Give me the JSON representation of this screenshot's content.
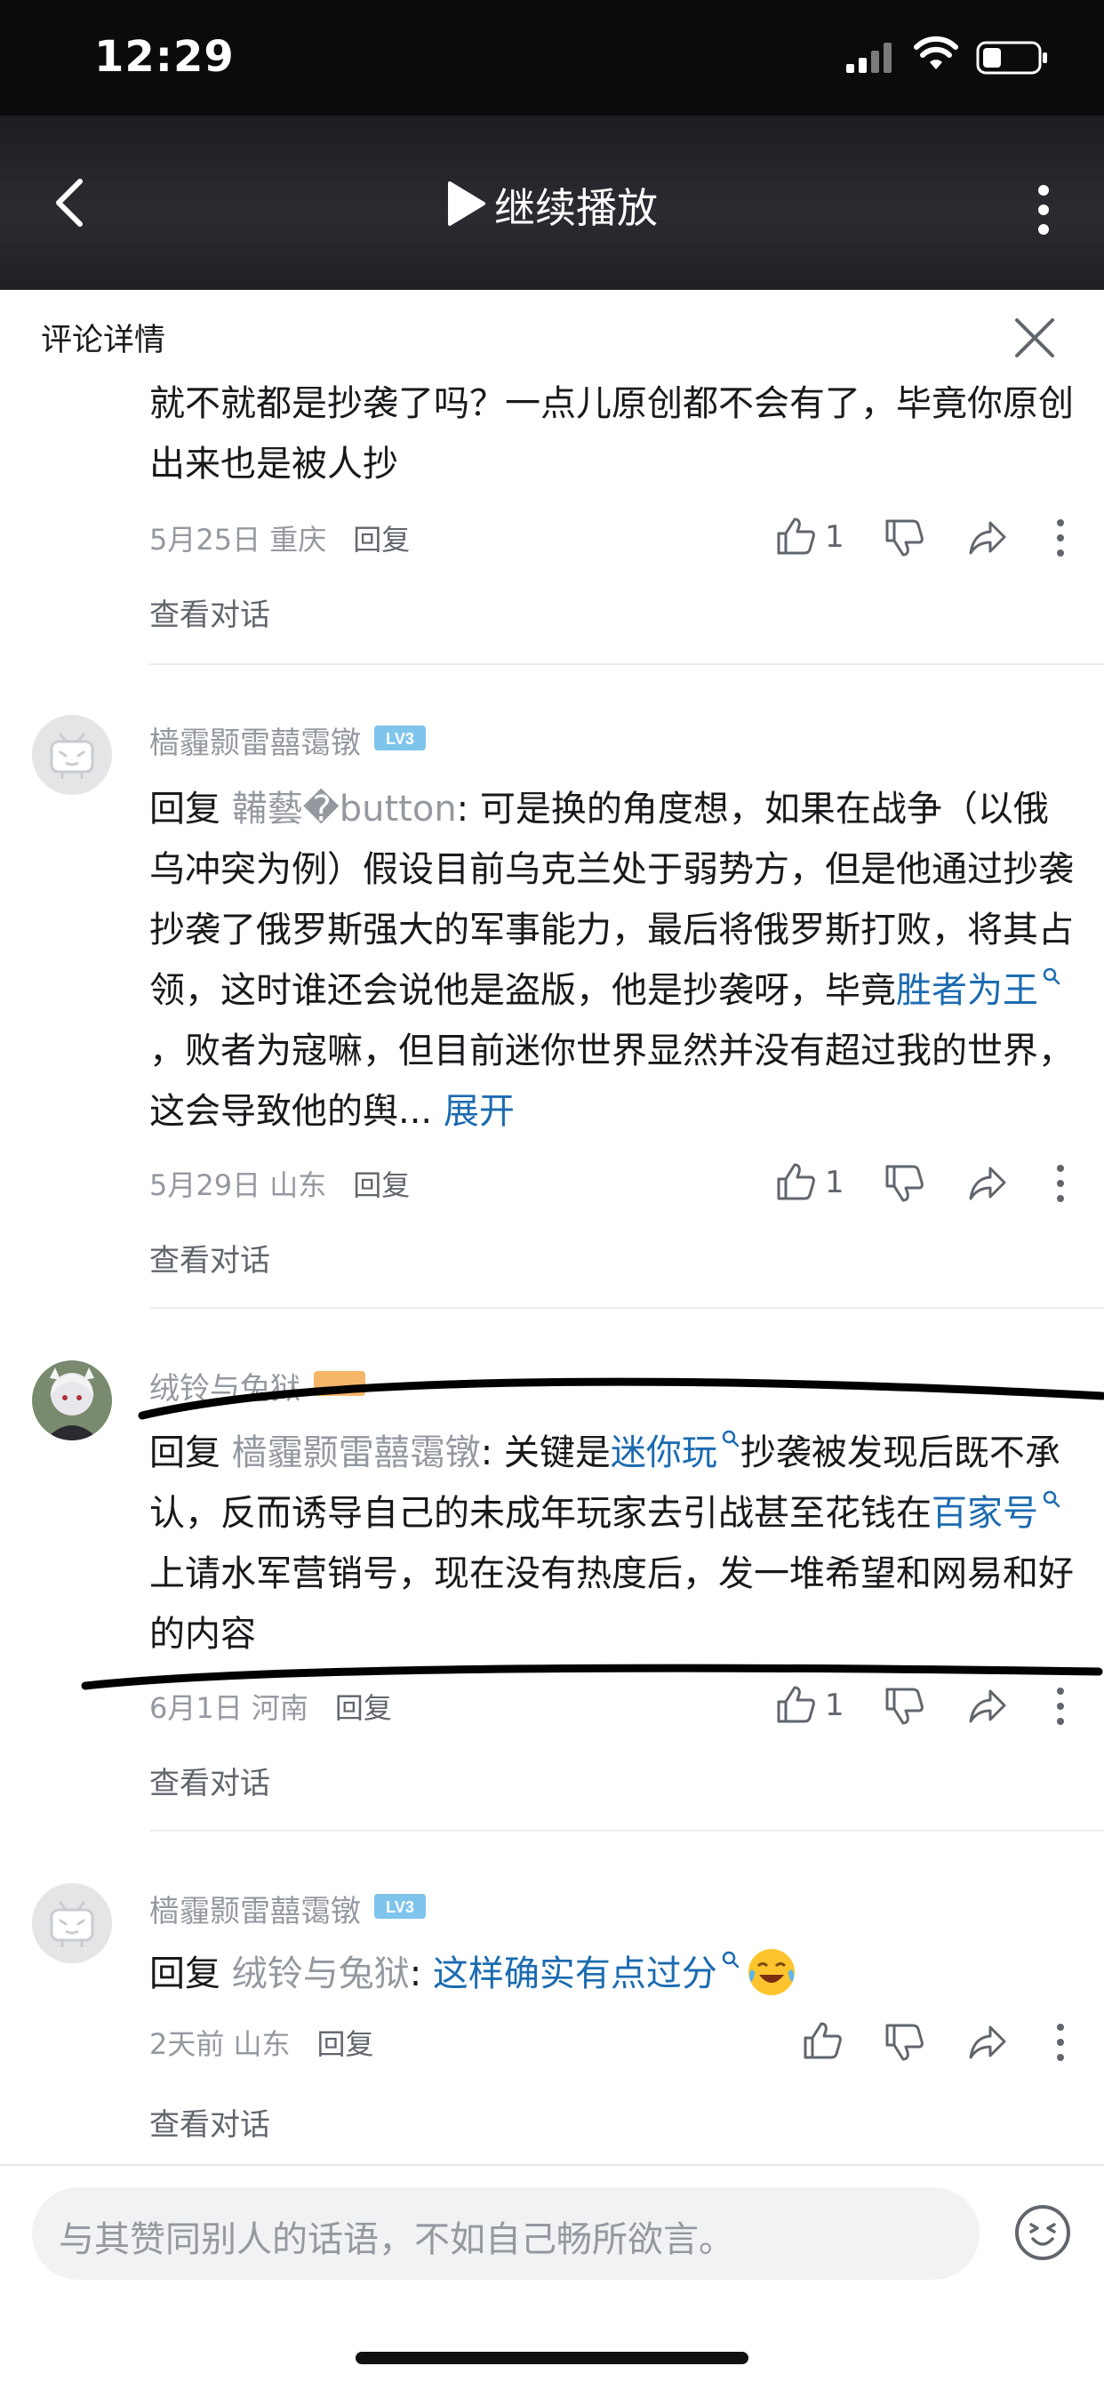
{
  "status_bar": {
    "time": "12:29"
  },
  "video_header": {
    "title": "继续播放"
  },
  "panel": {
    "title": "评论详情"
  },
  "comments": [
    {
      "text": "就不就都是抄袭了吗？一点儿原创都不会有了，毕竟你原创出来也是被人抄",
      "date": "5月25日 重庆",
      "reply_label": "回复",
      "likes": "1",
      "view_conversation": "查看对话"
    },
    {
      "username": "樯霾颢雷囍霭镦",
      "level_badge": "LV3",
      "reply_prefix": "回复",
      "reply_to": "韛藝�button",
      "text_a": "可是换的角度想，如果在战争（以俄乌冲突为例）假设目前乌克兰处于弱势方，但是他通过抄袭抄袭了俄罗斯强大的军事能力，最后将俄罗斯打败，将其占领，这时谁还会说他是盗版，他是抄袭呀，毕竟",
      "link": "胜者为王",
      "text_b": "，败者为寇嘛，但目前迷你世界显然并没有超过我的世界，这会导致他的舆...",
      "expand": "展开",
      "date": "5月29日 山东",
      "reply_label": "回复",
      "likes": "1",
      "view_conversation": "查看对话"
    },
    {
      "username": "绒铃与兔狱",
      "reply_prefix": "回复",
      "reply_to": "樯霾颢雷囍霭镦",
      "text_a": "关键是",
      "link1": "迷你玩",
      "text_b": "抄袭被发现后既不承认，反而诱导自己的未成年玩家去引战甚至花钱在",
      "link2": "百家号",
      "text_c": "上请水军营销号，现在没有热度后，发一堆希望和网易和好的内容",
      "date": "6月1日 河南",
      "reply_label": "回复",
      "likes": "1",
      "view_conversation": "查看对话"
    },
    {
      "username": "樯霾颢雷囍霭镦",
      "level_badge": "LV3",
      "reply_prefix": "回复",
      "reply_to": "绒铃与兔狱",
      "link": "这样确实有点过分",
      "date": "2天前 山东",
      "reply_label": "回复",
      "view_conversation": "查看对话"
    }
  ],
  "input": {
    "placeholder": "与其赞同别人的话语，不如自己畅所欲言。"
  },
  "colors": {
    "link": "#1c6bb0",
    "level_badge": "#7fc4ec",
    "muted": "#9499a0"
  }
}
